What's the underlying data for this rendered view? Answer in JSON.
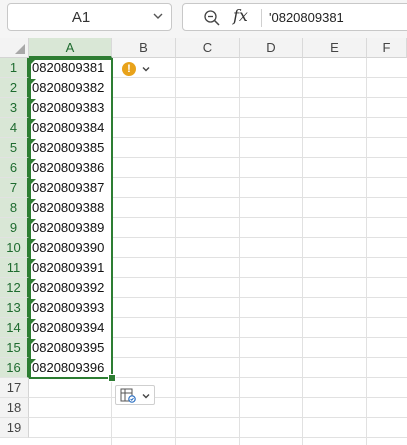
{
  "formula_bar": {
    "name_box": "A1",
    "fx_label": "fx",
    "value": "'0820809381"
  },
  "columns": [
    "A",
    "B",
    "C",
    "D",
    "E",
    "F"
  ],
  "rows": [
    "1",
    "2",
    "3",
    "4",
    "5",
    "6",
    "7",
    "8",
    "9",
    "10",
    "11",
    "12",
    "13",
    "14",
    "15",
    "16",
    "17",
    "18",
    "19"
  ],
  "cells_A": [
    "0820809381",
    "0820809382",
    "0820809383",
    "0820809384",
    "0820809385",
    "0820809386",
    "0820809387",
    "0820809388",
    "0820809389",
    "0820809390",
    "0820809391",
    "0820809392",
    "0820809393",
    "0820809394",
    "0820809395",
    "0820809396"
  ],
  "warning_badge": "!",
  "colors": {
    "accent": "#2d7d32",
    "warning": "#e8a21a"
  }
}
